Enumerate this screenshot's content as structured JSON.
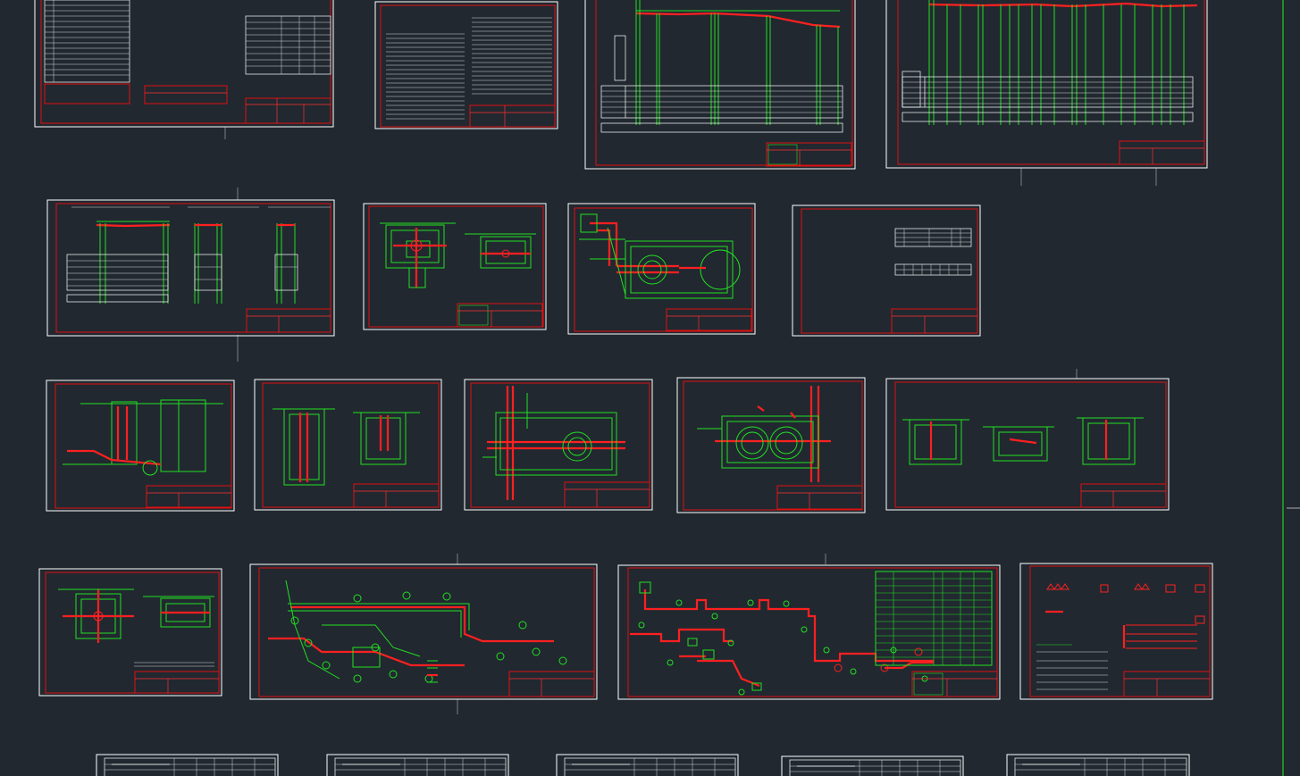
{
  "viewport": {
    "background": "#212830"
  },
  "colors": {
    "frame": "#e01010",
    "linework": "#22e022",
    "pipe": "#ff2020",
    "text": "#ffffff"
  },
  "sheets": [
    {
      "id": "sheet-1",
      "kind": "general-data"
    },
    {
      "id": "sheet-2",
      "kind": "notes"
    },
    {
      "id": "sheet-3",
      "kind": "profile"
    },
    {
      "id": "sheet-4",
      "kind": "profile"
    },
    {
      "id": "sheet-5",
      "kind": "profile-sections"
    },
    {
      "id": "sheet-6",
      "kind": "node-detail"
    },
    {
      "id": "sheet-7",
      "kind": "chamber-plan"
    },
    {
      "id": "sheet-8",
      "kind": "specification"
    },
    {
      "id": "sheet-9",
      "kind": "section"
    },
    {
      "id": "sheet-10",
      "kind": "sections"
    },
    {
      "id": "sheet-11",
      "kind": "chamber-plan"
    },
    {
      "id": "sheet-12",
      "kind": "chamber-plan"
    },
    {
      "id": "sheet-13",
      "kind": "sections"
    },
    {
      "id": "sheet-14",
      "kind": "node-detail"
    },
    {
      "id": "sheet-15",
      "kind": "site-plan"
    },
    {
      "id": "sheet-16",
      "kind": "network-scheme"
    },
    {
      "id": "sheet-17",
      "kind": "legend"
    },
    {
      "id": "sheet-18",
      "kind": "title-block"
    },
    {
      "id": "sheet-19",
      "kind": "title-block"
    },
    {
      "id": "sheet-20",
      "kind": "title-block"
    },
    {
      "id": "sheet-21",
      "kind": "title-block"
    },
    {
      "id": "sheet-22",
      "kind": "title-block"
    }
  ]
}
